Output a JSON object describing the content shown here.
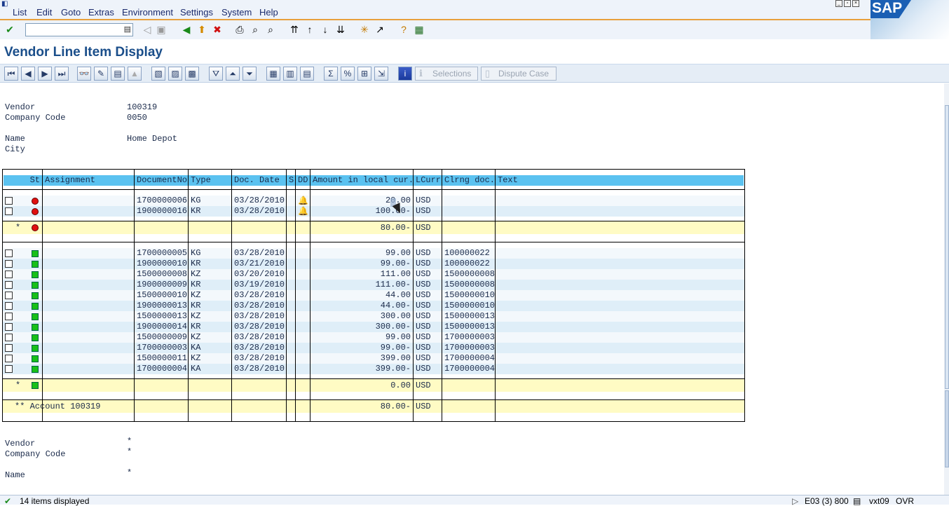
{
  "menubar": {
    "items": [
      "List",
      "Edit",
      "Goto",
      "Extras",
      "Environment",
      "Settings",
      "System",
      "Help"
    ],
    "logo_text": "SAP"
  },
  "toolbar": {
    "command_field_value": "",
    "icons": [
      "enter-icon",
      "command-field-dropdown-icon",
      "back-nav-icon",
      "save-icon",
      "back-icon",
      "exit-icon",
      "cancel-icon",
      "print-icon",
      "find-icon",
      "find-next-icon",
      "first-page-icon",
      "previous-page-icon",
      "next-page-icon",
      "last-page-icon",
      "new-session-icon",
      "shortcut-icon",
      "help-icon",
      "customize-layout-icon"
    ]
  },
  "page": {
    "title": "Vendor Line Item Display"
  },
  "app_toolbar": {
    "selections_label": "Selections",
    "dispute_case_label": "Dispute Case"
  },
  "header": {
    "vendor_label": "Vendor",
    "vendor_value": "100319",
    "company_code_label": "Company Code",
    "company_code_value": "0050",
    "name_label": "Name",
    "name_value": "Home Depot",
    "city_label": "City",
    "city_value": ""
  },
  "grid": {
    "columns": [
      "St",
      "Assignment",
      "DocumentNo",
      "Type",
      "Doc. Date",
      "S",
      "DD",
      "Amount in local cur.",
      "LCurr",
      "Clrng doc.",
      "Text"
    ],
    "open_items": [
      {
        "doc": "1700000006",
        "type": "KG",
        "date": "03/28/2010",
        "amount": "20.00",
        "curr": "USD",
        "clrng": ""
      },
      {
        "doc": "1900000016",
        "type": "KR",
        "date": "03/28/2010",
        "amount": "100.00-",
        "curr": "USD",
        "clrng": ""
      }
    ],
    "open_subtotal": {
      "star": "*",
      "amount": "80.00-",
      "curr": "USD"
    },
    "cleared_items": [
      {
        "doc": "1700000005",
        "type": "KG",
        "date": "03/28/2010",
        "amount": "99.00",
        "curr": "USD",
        "clrng": "100000022"
      },
      {
        "doc": "1900000010",
        "type": "KR",
        "date": "03/21/2010",
        "amount": "99.00-",
        "curr": "USD",
        "clrng": "100000022"
      },
      {
        "doc": "1500000008",
        "type": "KZ",
        "date": "03/20/2010",
        "amount": "111.00",
        "curr": "USD",
        "clrng": "1500000008"
      },
      {
        "doc": "1900000009",
        "type": "KR",
        "date": "03/19/2010",
        "amount": "111.00-",
        "curr": "USD",
        "clrng": "1500000008"
      },
      {
        "doc": "1500000010",
        "type": "KZ",
        "date": "03/28/2010",
        "amount": "44.00",
        "curr": "USD",
        "clrng": "1500000010"
      },
      {
        "doc": "1900000013",
        "type": "KR",
        "date": "03/28/2010",
        "amount": "44.00-",
        "curr": "USD",
        "clrng": "1500000010"
      },
      {
        "doc": "1500000013",
        "type": "KZ",
        "date": "03/28/2010",
        "amount": "300.00",
        "curr": "USD",
        "clrng": "1500000013"
      },
      {
        "doc": "1900000014",
        "type": "KR",
        "date": "03/28/2010",
        "amount": "300.00-",
        "curr": "USD",
        "clrng": "1500000013"
      },
      {
        "doc": "1500000009",
        "type": "KZ",
        "date": "03/28/2010",
        "amount": "99.00",
        "curr": "USD",
        "clrng": "1700000003"
      },
      {
        "doc": "1700000003",
        "type": "KA",
        "date": "03/28/2010",
        "amount": "99.00-",
        "curr": "USD",
        "clrng": "1700000003"
      },
      {
        "doc": "1500000011",
        "type": "KZ",
        "date": "03/28/2010",
        "amount": "399.00",
        "curr": "USD",
        "clrng": "1700000004"
      },
      {
        "doc": "1700000004",
        "type": "KA",
        "date": "03/28/2010",
        "amount": "399.00-",
        "curr": "USD",
        "clrng": "1700000004"
      }
    ],
    "cleared_subtotal": {
      "star": "*",
      "amount": "0.00",
      "curr": "USD"
    },
    "account_total": {
      "label": "** Account 100319",
      "amount": "80.00-",
      "curr": "USD"
    }
  },
  "footer_header": {
    "vendor_label": "Vendor",
    "vendor_value": "*",
    "company_code_label": "Company Code",
    "company_code_value": "*",
    "name_label": "Name",
    "name_value": "*"
  },
  "status": {
    "message": "14 items displayed",
    "system": "E03 (3) 800",
    "server": "vxt09",
    "mode": "OVR"
  },
  "colors": {
    "column_header": "#5bc2f0",
    "subtotal_row": "#fffbc4",
    "alt_row": "#dfeef8",
    "title": "#1a4e8a"
  }
}
